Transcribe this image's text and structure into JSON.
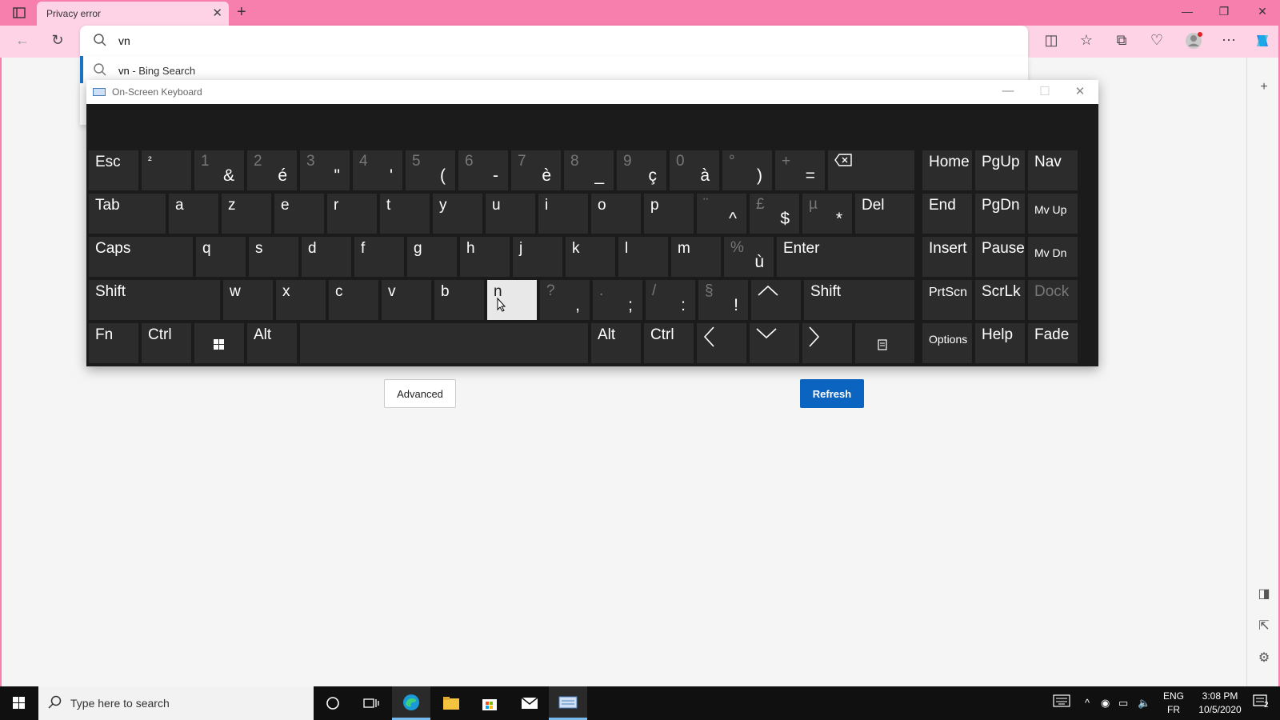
{
  "browser": {
    "tab_title": "Privacy error",
    "address_value": "vn",
    "suggestion_query": "vn",
    "suggestion_suffix": " - Bing Search"
  },
  "page": {
    "advanced_label": "Advanced",
    "refresh_label": "Refresh"
  },
  "osk": {
    "title": "On-Screen Keyboard",
    "keys": {
      "esc": "Esc",
      "sup2": "²",
      "k1s": "1",
      "k1p": "&",
      "k2s": "2",
      "k2p": "é",
      "k3s": "3",
      "k3p": "\"",
      "k4s": "4",
      "k4p": "'",
      "k5s": "5",
      "k5p": "(",
      "k6s": "6",
      "k6p": "-",
      "k7s": "7",
      "k7p": "è",
      "k8s": "8",
      "k8p": "_",
      "k9s": "9",
      "k9p": "ç",
      "k0s": "0",
      "k0p": "à",
      "degs": "°",
      "degp": ")",
      "pluss": "+",
      "plusp": "=",
      "home": "Home",
      "pgup": "PgUp",
      "nav": "Nav",
      "tab": "Tab",
      "a": "a",
      "z": "z",
      "e": "e",
      "r": "r",
      "t": "t",
      "y": "y",
      "u": "u",
      "i": "i",
      "o": "o",
      "p": "p",
      "dias": "¨",
      "diap": "^",
      "pounds": "£",
      "poundp": "$",
      "mus": "µ",
      "mup": "*",
      "del": "Del",
      "end": "End",
      "pgdn": "PgDn",
      "mvup": "Mv Up",
      "caps": "Caps",
      "q": "q",
      "s": "s",
      "d": "d",
      "f": "f",
      "g": "g",
      "h": "h",
      "j": "j",
      "k": "k",
      "l": "l",
      "m": "m",
      "pcts": "%",
      "pctp": "ù",
      "enter": "Enter",
      "insert": "Insert",
      "pause": "Pause",
      "mvdn": "Mv Dn",
      "shift": "Shift",
      "w": "w",
      "x": "x",
      "c": "c",
      "v": "v",
      "b": "b",
      "n": "n",
      "qs": "?",
      "qp": ",",
      "dots": ".",
      "dotp": ";",
      "slashs": "/",
      "slashp": ":",
      "sects": "§",
      "sectp": "!",
      "rshift": "Shift",
      "prtscn": "PrtScn",
      "scrlk": "ScrLk",
      "dock": "Dock",
      "fn": "Fn",
      "ctrl": "Ctrl",
      "alt": "Alt",
      "altgr": "Alt",
      "rctrl": "Ctrl",
      "options": "Options",
      "help": "Help",
      "fade": "Fade"
    }
  },
  "taskbar": {
    "search_placeholder": "Type here to search",
    "lang1": "ENG",
    "lang2": "FR",
    "time": "3:08 PM",
    "date": "10/5/2020",
    "notif_count": "2"
  }
}
